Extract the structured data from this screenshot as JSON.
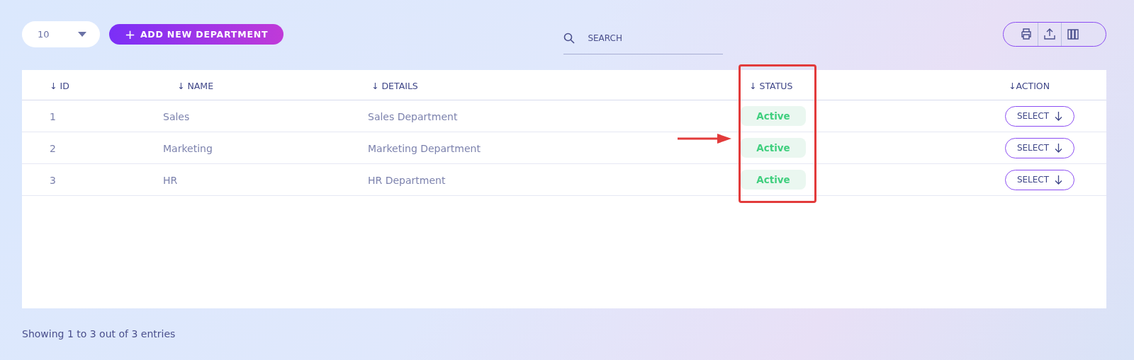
{
  "page_size": {
    "value": "10"
  },
  "add_button": {
    "icon": "+",
    "label": "ADD NEW DEPARTMENT"
  },
  "search": {
    "placeholder": "SEARCH"
  },
  "table": {
    "columns": [
      {
        "label": "ID",
        "sort_icon": "↓"
      },
      {
        "label": "NAME",
        "sort_icon": "↓"
      },
      {
        "label": "DETAILS",
        "sort_icon": "↓"
      },
      {
        "label": "STATUS",
        "sort_icon": "↓"
      },
      {
        "label": "ACTION",
        "sort_icon": "↓"
      }
    ],
    "rows": [
      {
        "id": "1",
        "name": "Sales",
        "details": "Sales Department",
        "status": "Active",
        "action": "SELECT"
      },
      {
        "id": "2",
        "name": "Marketing",
        "details": "Marketing Department",
        "status": "Active",
        "action": "SELECT"
      },
      {
        "id": "3",
        "name": "HR",
        "details": "HR Department",
        "status": "Active",
        "action": "SELECT"
      }
    ]
  },
  "footer": "Showing 1 to 3 out of 3 entries"
}
